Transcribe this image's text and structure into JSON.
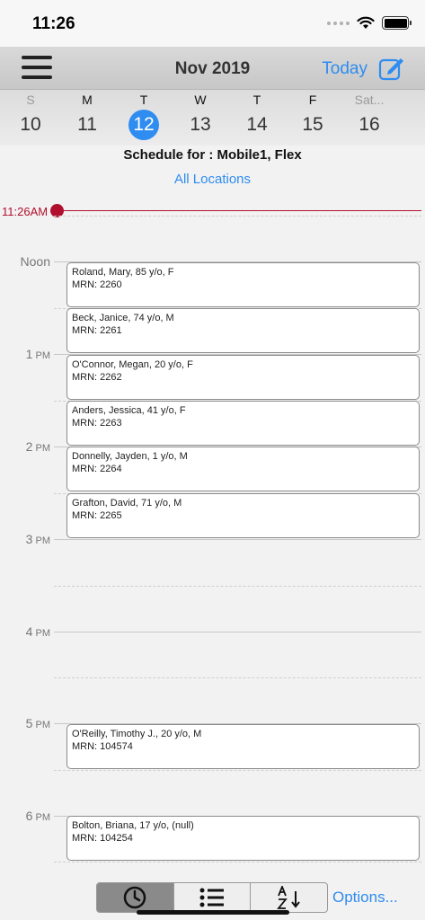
{
  "status": {
    "time": "11:26"
  },
  "nav": {
    "title": "Nov 2019",
    "today_label": "Today",
    "menu_icon": "hamburger-menu-icon",
    "edit_icon": "compose-icon"
  },
  "week": {
    "days": [
      {
        "name": "S",
        "date": "10"
      },
      {
        "name": "M",
        "date": "11"
      },
      {
        "name": "T",
        "date": "12"
      },
      {
        "name": "W",
        "date": "13"
      },
      {
        "name": "T",
        "date": "14"
      },
      {
        "name": "F",
        "date": "15"
      },
      {
        "name": "Sat...",
        "date": "16"
      }
    ],
    "selected_date": "12"
  },
  "schedule": {
    "title": "Schedule for : Mobile1, Flex",
    "locations_label": "All Locations"
  },
  "now": {
    "label": "11:26AM"
  },
  "hours": [
    {
      "label": "Noon",
      "suffix": ""
    },
    {
      "label": "1",
      "suffix": " PM"
    },
    {
      "label": "2",
      "suffix": " PM"
    },
    {
      "label": "3",
      "suffix": " PM"
    },
    {
      "label": "4",
      "suffix": " PM"
    },
    {
      "label": "5",
      "suffix": " PM"
    },
    {
      "label": "6",
      "suffix": " PM"
    }
  ],
  "appointments": [
    {
      "patient": "Roland, Mary, 85 y/o, F",
      "mrn": "MRN: 2260"
    },
    {
      "patient": "Beck, Janice, 74 y/o, M",
      "mrn": "MRN: 2261"
    },
    {
      "patient": "O'Connor, Megan, 20 y/o, F",
      "mrn": "MRN: 2262"
    },
    {
      "patient": "Anders, Jessica, 41 y/o, F",
      "mrn": "MRN: 2263"
    },
    {
      "patient": "Donnelly, Jayden, 1 y/o, M",
      "mrn": "MRN: 2264"
    },
    {
      "patient": "Grafton, David, 71 y/o, M",
      "mrn": "MRN: 2265"
    },
    {
      "patient": "O'Reilly, Timothy J., 20 y/o, M",
      "mrn": "MRN: 104574"
    },
    {
      "patient": "Bolton, Briana, 17 y/o, (null)",
      "mrn": "MRN: 104254"
    }
  ],
  "toolbar": {
    "views": [
      {
        "icon": "clock-icon",
        "active": true
      },
      {
        "icon": "list-icon",
        "active": false
      },
      {
        "icon": "sort-az-icon",
        "active": false
      }
    ],
    "options_label": "Options..."
  },
  "colors": {
    "accent": "#2f8cf0",
    "now_indicator": "#b0102e"
  }
}
